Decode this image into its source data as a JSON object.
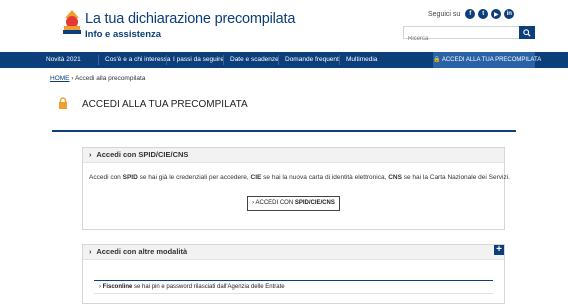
{
  "header": {
    "title": "La tua dichiarazione precompilata",
    "subtitle": "Info e assistenza",
    "social_label": "Seguici su",
    "social": [
      {
        "name": "facebook-icon",
        "glyph": "f"
      },
      {
        "name": "twitter-icon",
        "glyph": "t"
      },
      {
        "name": "youtube-icon",
        "glyph": "▶"
      },
      {
        "name": "linkedin-icon",
        "glyph": "in"
      }
    ],
    "search_placeholder": "Ricerca"
  },
  "nav": {
    "items": [
      "Novità 2021",
      "Cos'è e a chi interessa",
      "I passi da seguire",
      "Date e scadenze",
      "Domande frequenti",
      "Multimedia"
    ],
    "cta": "ACCEDI ALLA TUA PRECOMPILATA"
  },
  "breadcrumb": {
    "home": "HOME",
    "current": "Accedi alla precompilata"
  },
  "page": {
    "title": "ACCEDI ALLA TUA PRECOMPILATA"
  },
  "panel_spid": {
    "heading": "Accedi con SPID/CIE/CNS",
    "desc_1": "Accedi con ",
    "desc_spid": "SPID",
    "desc_2": " se hai già le credenziali per accedere, ",
    "desc_cie": "CIE",
    "desc_3": " se hai la nuova carta di identità elettronica, ",
    "desc_cns": "CNS",
    "desc_4": " se hai la Carta Nazionale dei Servizi.",
    "button_prefix": "ACCEDI CON ",
    "button_bold": "SPID/CIE/CNS"
  },
  "panel_other": {
    "heading": "Accedi con altre modalità",
    "items": [
      {
        "bold": "Fisconline",
        "text": " se hai pin e password rilasciati dall'Agenzia delle Entrate"
      }
    ]
  },
  "colors": {
    "brand": "#0b3e7a",
    "cta": "#2a62a8",
    "lock": "#f0a030"
  }
}
